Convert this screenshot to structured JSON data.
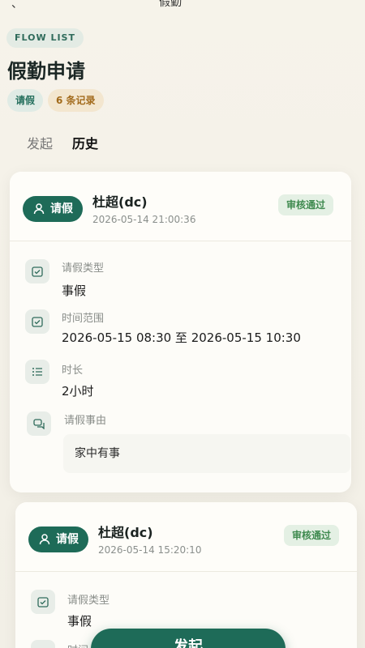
{
  "topbar": {
    "back": "、",
    "title": "假勤"
  },
  "header": {
    "badge": "FLOW LIST",
    "title": "假勤申请",
    "type_chip": "请假",
    "count_chip": "6 条记录"
  },
  "tabs": [
    {
      "label": "发起"
    },
    {
      "label": "历史"
    }
  ],
  "labels": {
    "leave_type": "请假类型",
    "time_range": "时间范围",
    "duration": "时长",
    "reason": "请假事由"
  },
  "records": [
    {
      "type": "请假",
      "applicant": "杜超(dc)",
      "submitted": "2026-05-14 21:00:36",
      "status": "审核通过",
      "leave_type": "事假",
      "time_range": "2026-05-15 08:30 至 2026-05-15 10:30",
      "duration": "2小时",
      "reason": "家中有事"
    },
    {
      "type": "请假",
      "applicant": "杜超(dc)",
      "submitted": "2026-05-14 15:20:10",
      "status": "审核通过",
      "leave_type": "事假",
      "time_range_label": "时间"
    }
  ],
  "fab": {
    "label": "发起"
  },
  "colors": {
    "primary": "#1e6b58",
    "status_green": "#3f8a4f",
    "count_chip": "#a26a1b"
  }
}
